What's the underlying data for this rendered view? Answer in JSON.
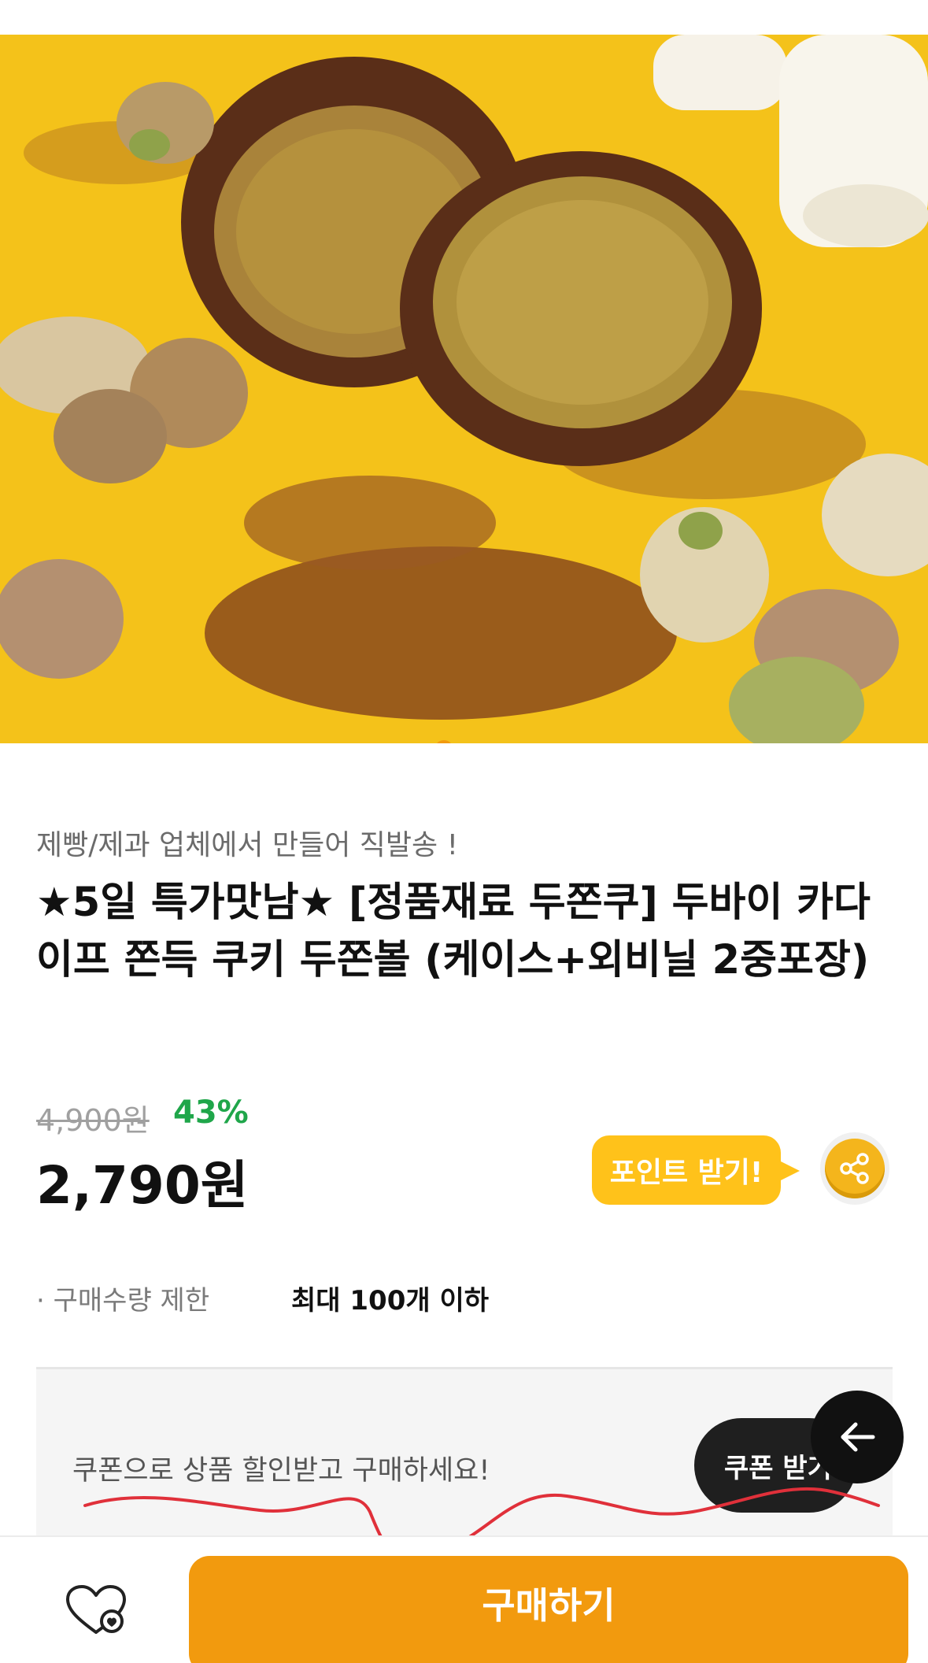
{
  "gallery": {
    "image_alt": "",
    "slide_count": 4,
    "active_slide": 2
  },
  "product": {
    "subtitle": "제빵/제과 업체에서 만들어 직발송 !",
    "title": "★5일 특가맛남★ [정품재료 두쫀쿠] 두바이 카다이프 쫀득 쿠키 두쫀볼 (케이스+외비닐 2중포장)",
    "original_price": "4,900원",
    "discount_rate": "43%",
    "price": "2,790원"
  },
  "points": {
    "bubble_label": "포인트 받기!",
    "icon": "share-icon"
  },
  "purchase_limit": {
    "label": "· 구매수량 제한",
    "value": "최대 100개 이하"
  },
  "coupon": {
    "text": "쿠폰으로 상품 할인받고 구매하세요!",
    "button_label": "쿠폰 받기"
  },
  "bottom_bar": {
    "like_icon": "heart-icon",
    "buy_label": "구매하기"
  },
  "colors": {
    "accent_orange": "#f29a0e",
    "point_yellow": "#ffc21a",
    "discount_green": "#1fa64a",
    "hero_background": "#f4c21a"
  }
}
